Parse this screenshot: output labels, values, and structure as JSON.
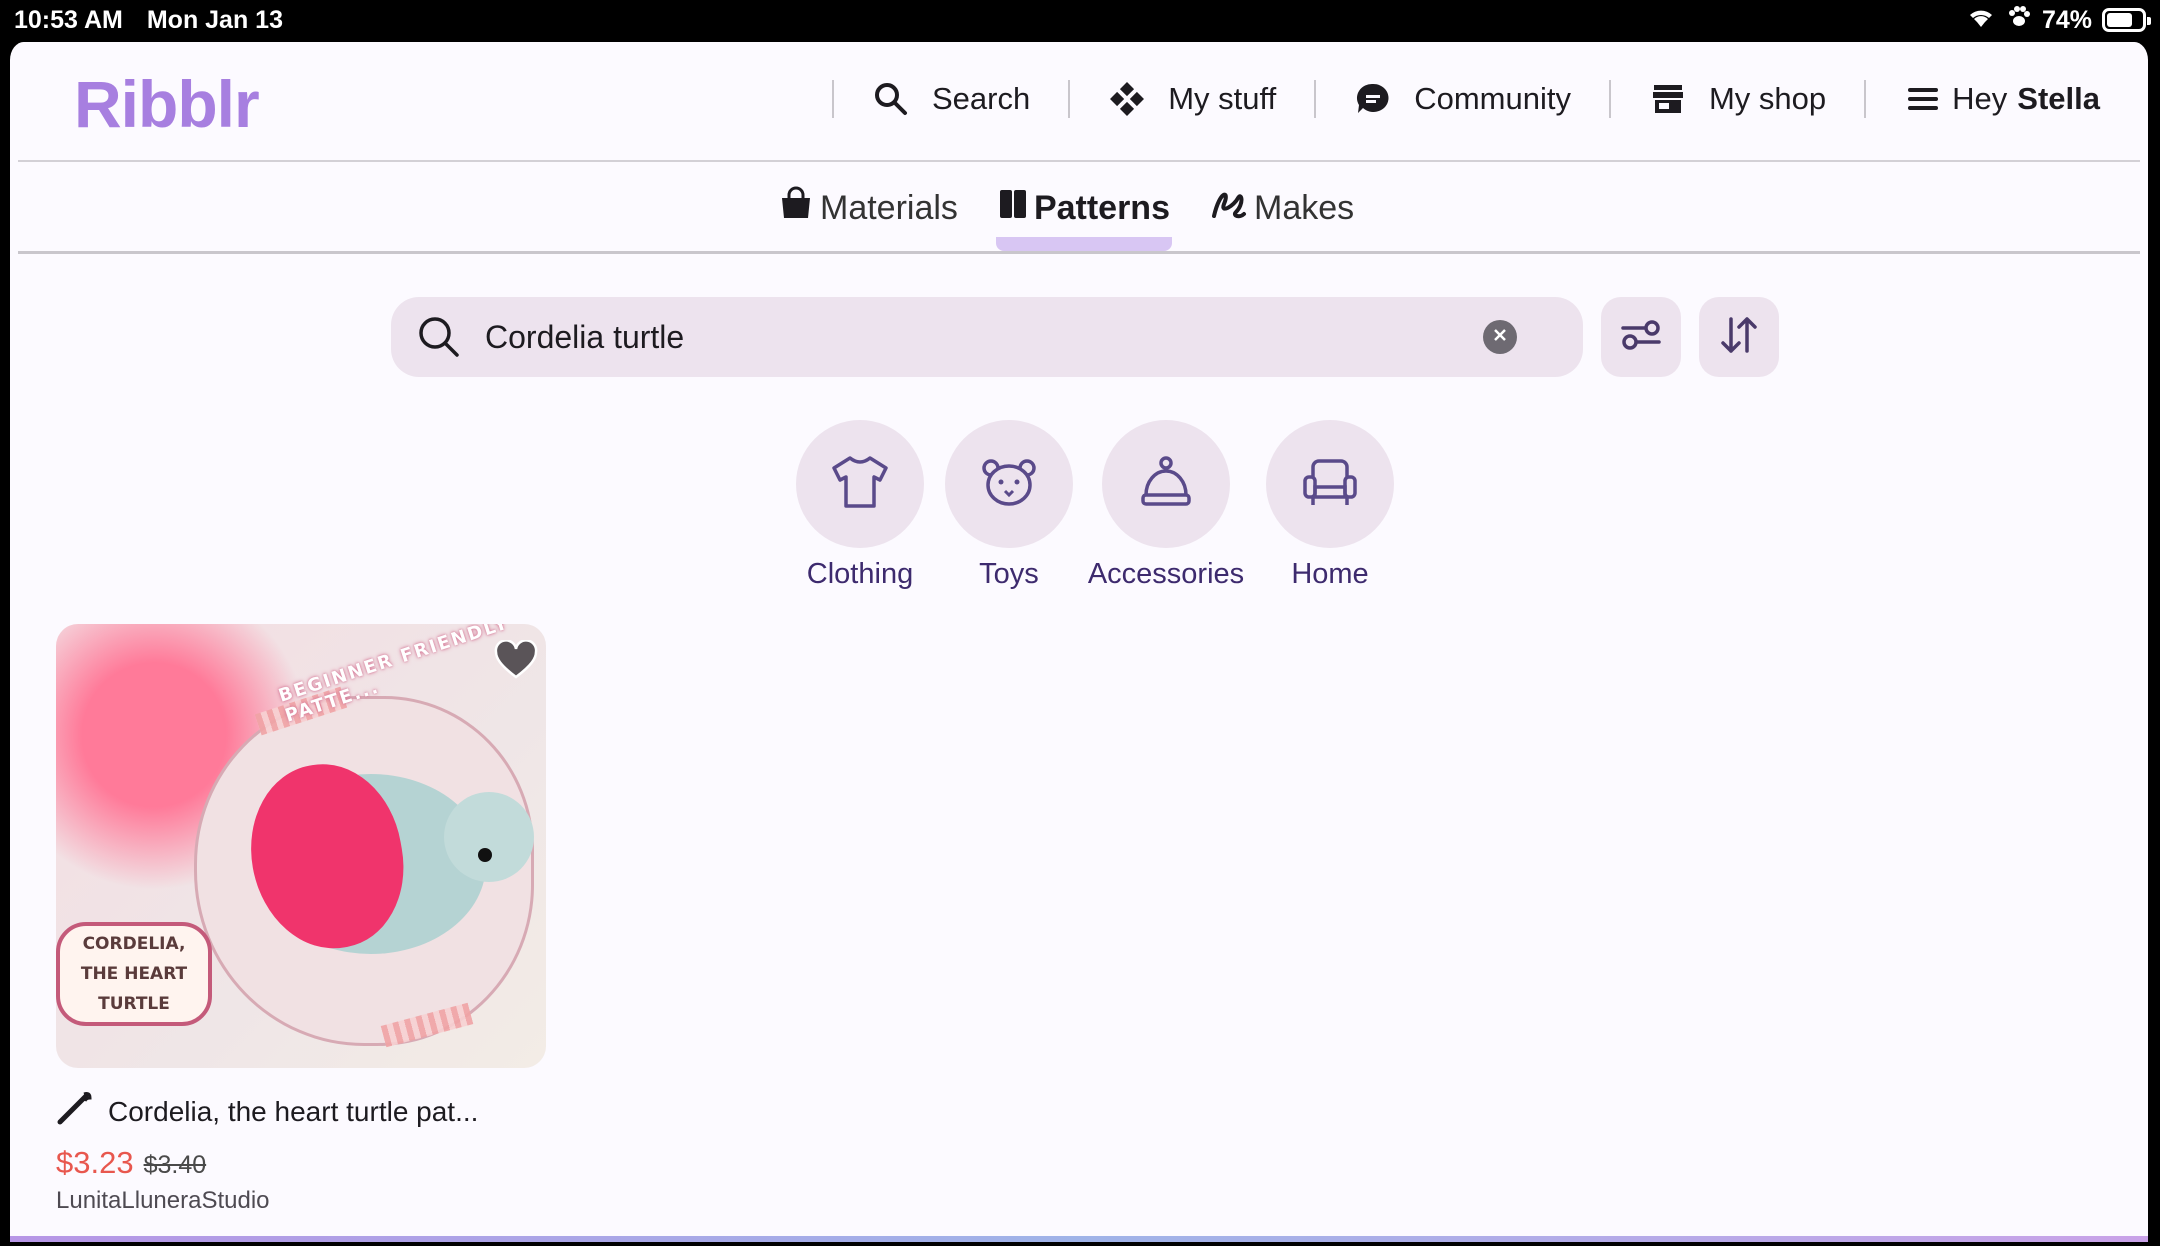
{
  "status_bar": {
    "time": "10:53 AM",
    "date": "Mon Jan 13",
    "battery": "74%",
    "battery_level": 0.74,
    "icons": [
      "wifi-icon",
      "paw-icon",
      "battery-icon"
    ]
  },
  "app": {
    "logo": "Ribblr",
    "brand_color": "#a77fe0"
  },
  "nav": {
    "search": "Search",
    "my_stuff": "My stuff",
    "community": "Community",
    "my_shop": "My shop",
    "greeting_prefix": "Hey",
    "user_name": "Stella"
  },
  "subtabs": {
    "materials": "Materials",
    "patterns": "Patterns",
    "makes": "Makes",
    "active": "Patterns"
  },
  "search": {
    "value": "Cordelia turtle",
    "placeholder": ""
  },
  "categories": [
    {
      "label": "Clothing",
      "icon": "tshirt-icon"
    },
    {
      "label": "Toys",
      "icon": "teddy-bear-icon"
    },
    {
      "label": "Accessories",
      "icon": "beanie-icon"
    },
    {
      "label": "Home",
      "icon": "armchair-icon"
    }
  ],
  "results": [
    {
      "title": "Cordelia, the heart turtle pat...",
      "price": "$3.23",
      "old_price": "$3.40",
      "seller": "LunitaLluneraStudio",
      "image_text_top": "BEGINNER FRIENDLY PATTE...",
      "image_label_lines": [
        "CORDELIA,",
        "THE HEART",
        "TURTLE"
      ],
      "type_icon": "crochet-hook-icon"
    }
  ],
  "colors": {
    "price": "#e8574e",
    "chip_bg": "#ede3ee",
    "category_text": "#3d2a6e",
    "tab_indicator": "#d8c6f3"
  }
}
